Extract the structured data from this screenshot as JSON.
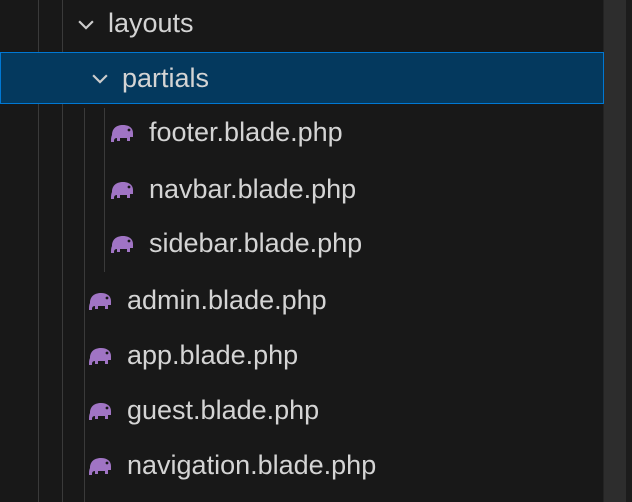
{
  "explorer": {
    "folders": [
      {
        "label": "layouts",
        "icon": "chevron-down-icon"
      },
      {
        "label": "partials",
        "icon": "chevron-down-icon",
        "selected": true
      }
    ],
    "partial_files": [
      {
        "label": "footer.blade.php",
        "icon": "elephant-icon"
      },
      {
        "label": "navbar.blade.php",
        "icon": "elephant-icon"
      },
      {
        "label": "sidebar.blade.php",
        "icon": "elephant-icon"
      }
    ],
    "layout_files": [
      {
        "label": "admin.blade.php",
        "icon": "elephant-icon"
      },
      {
        "label": "app.blade.php",
        "icon": "elephant-icon"
      },
      {
        "label": "guest.blade.php",
        "icon": "elephant-icon"
      },
      {
        "label": "navigation.blade.php",
        "icon": "elephant-icon"
      }
    ],
    "colors": {
      "background": "#181818",
      "selection": "#04395e",
      "selection_border": "#0078d4",
      "icon": "#a074c4",
      "text": "#d4d4d4"
    }
  }
}
